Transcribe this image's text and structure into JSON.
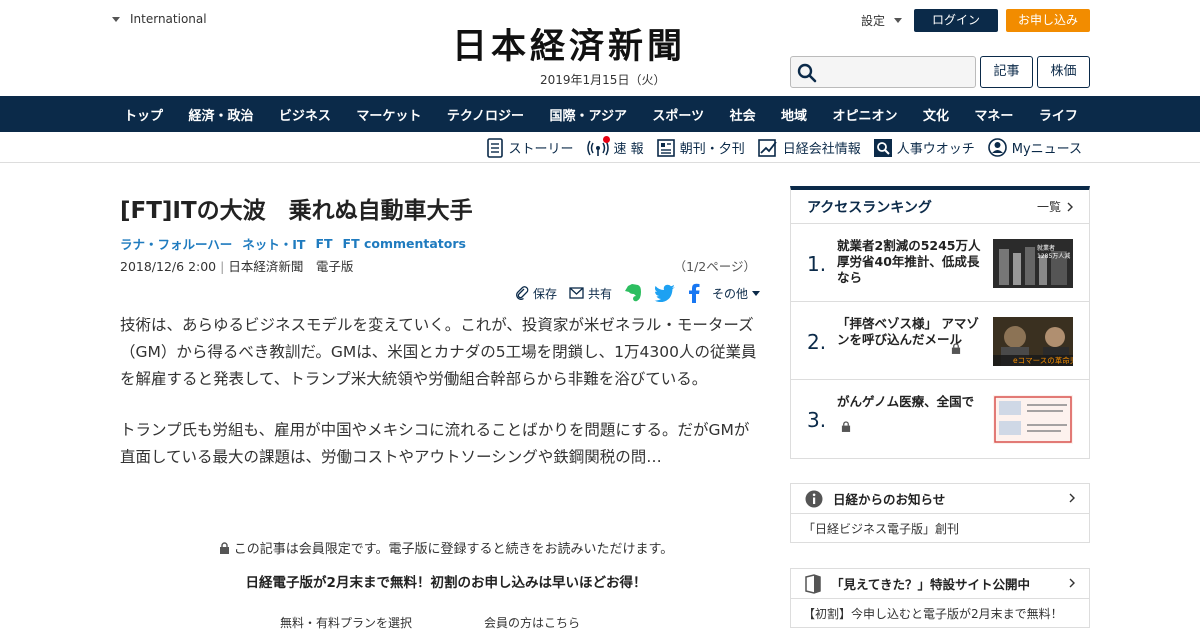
{
  "header": {
    "edition": "International",
    "logo": "日本経済新聞",
    "date": "2019年1月15日（火）",
    "settings": "設定",
    "login": "ログイン",
    "signup": "お申し込み",
    "search_placeholder": "",
    "btn_article": "記事",
    "btn_stock": "株価"
  },
  "nav": [
    "トップ",
    "経済・政治",
    "ビジネス",
    "マーケット",
    "テクノロジー",
    "国際・アジア",
    "スポーツ",
    "社会",
    "地域",
    "オピニオン",
    "文化",
    "マネー",
    "ライフ"
  ],
  "subnav": {
    "story": "ストーリー",
    "breaking": "速 報",
    "paper": "朝刊・夕刊",
    "company": "日経会社情報",
    "personnel": "人事ウオッチ",
    "mynews": "Myニュース"
  },
  "article": {
    "title": "[FT]ITの大波　乗れぬ自動車大手",
    "tags": [
      "ラナ・フォルーハー",
      "ネット・IT",
      "FT",
      "FT commentators"
    ],
    "datetime": "2018/12/6 2:00",
    "source": "日本経済新聞　電子版",
    "pages": "（1/2ページ）",
    "share": {
      "save": "保存",
      "share": "共有",
      "other": "その他"
    },
    "paragraphs": [
      "技術は、あらゆるビジネスモデルを変えていく。これが、投資家が米ゼネラル・モーターズ（GM）から得るべき教訓だ。GMは、米国とカナダの5工場を閉鎖し、1万4300人の従業員を解雇すると発表して、トランプ米大統領や労働組合幹部らから非難を浴びている。",
      "トランプ氏も労組も、雇用が中国やメキシコに流れることばかりを問題にする。だがGMが直面している最大の課題は、労働コストやアウトソーシングや鉄鋼関税の問…"
    ],
    "paywall_note": "この記事は会員限定です。電子版に登録すると続きをお読みいただけます。",
    "promo": "日経電子版が2月末まで無料！初割のお申し込みは早いほどお得！",
    "plan_select": "無料・有料プランを選択",
    "member_login": "会員の方はこちら"
  },
  "ranking": {
    "title": "アクセスランキング",
    "more": "一覧",
    "items": [
      {
        "num": "1.",
        "text": "就業者2割減の5245万人 厚労省40年推計、低成長なら",
        "thumb_text": "就業者 1285万人減"
      },
      {
        "num": "2.",
        "text": "「拝啓ベゾス様」 アマゾンを呼び込んだメール",
        "thumb_text": "eコマースの革命児"
      },
      {
        "num": "3.",
        "text": "がんゲノム医療、全国で",
        "thumb_text": ""
      }
    ]
  },
  "notices": [
    {
      "head": "日経からのお知らせ",
      "body": "「日経ビジネス電子版」創刊"
    },
    {
      "head": "「見えてきた？」特設サイト公開中",
      "body": "【初割】今申し込むと電子版が2月末まで無料！"
    }
  ],
  "colors": {
    "navy": "#0b2a49",
    "orange": "#f28c00",
    "link": "#1f7bbf",
    "evernote": "#2dbe60",
    "twitter": "#1da1f2",
    "facebook": "#1877f2"
  }
}
